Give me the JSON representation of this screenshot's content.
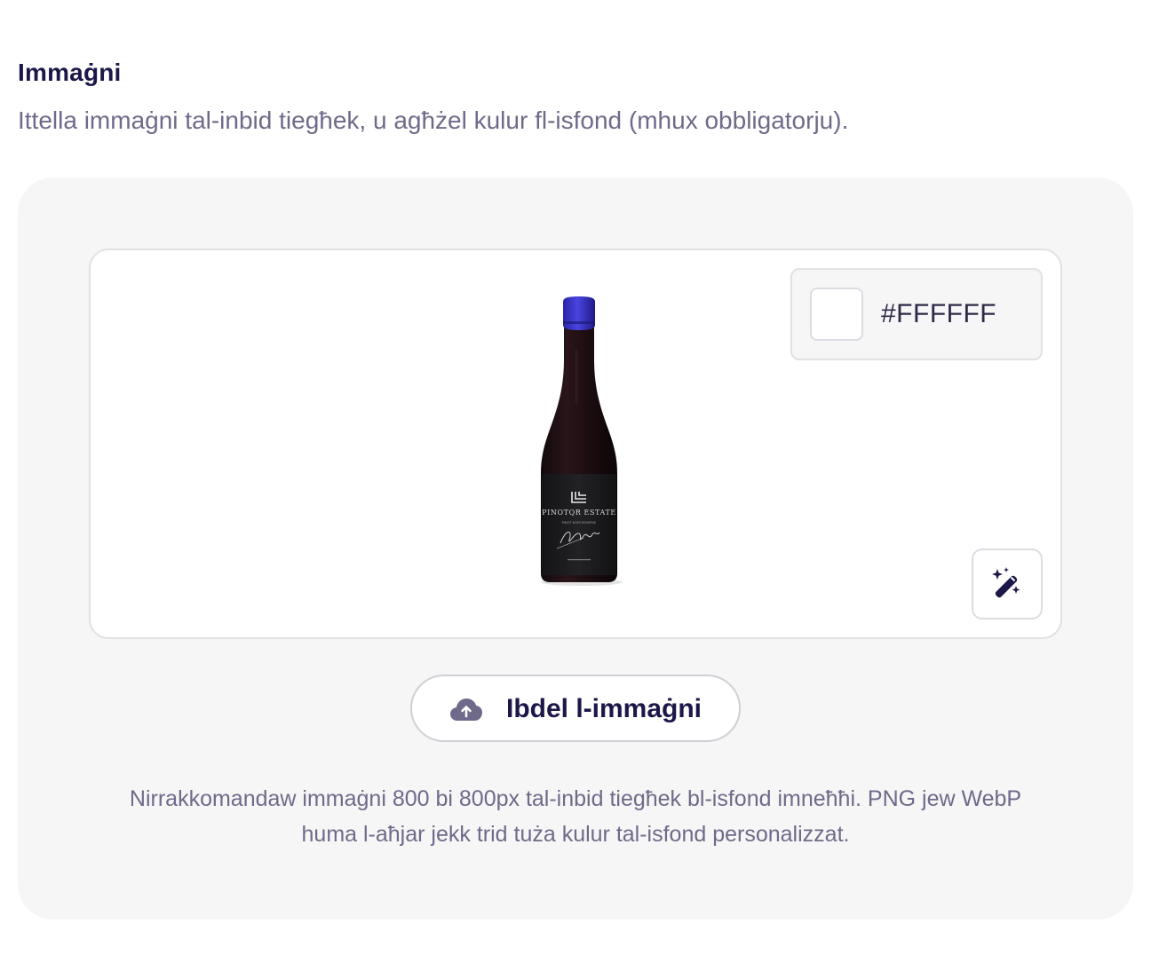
{
  "section": {
    "title": "Immaġni",
    "description": "Ittella immaġni tal-inbid tiegħek, u agħżel kulur fl-isfond (mhux obbligatorju)."
  },
  "preview": {
    "image_alt": "wine-bottle",
    "label": {
      "brand": "PINOTQR ESTATE",
      "sub": "PINOT NOIR RESERVE"
    },
    "background_color": {
      "hex_text": "#FFFFFF",
      "swatch": "#FFFFFF"
    },
    "magic_icon": "magic-wand-icon"
  },
  "upload": {
    "label": "Ibdel l-immaġni",
    "icon": "cloud-upload-icon"
  },
  "hint": {
    "line1": "Nirrakkomandaw immaġni 800 bi 800px tal-inbid tiegħek bl-isfond imneħħi. PNG jew WebP",
    "line2": "huma l-aħjar jekk trid tuża kulur tal-isfond personalizzat."
  },
  "colors": {
    "title": "#1b1748",
    "muted": "#6f6a8a",
    "card_bg": "#f6f6f6",
    "capsule": "#3b35c9"
  }
}
